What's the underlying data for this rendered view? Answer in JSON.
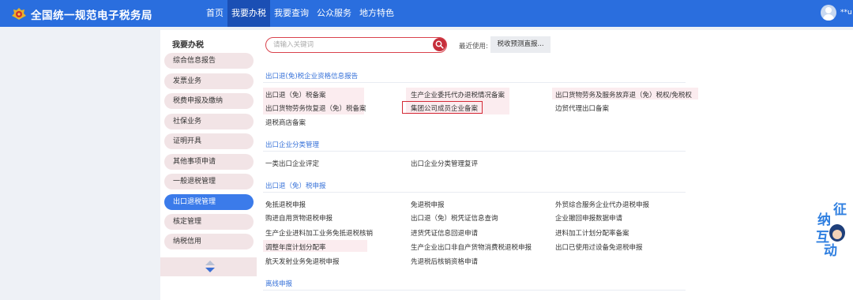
{
  "header": {
    "site_title": "全国统一规范电子税务局",
    "nav": [
      "首页",
      "我要办税",
      "我要查询",
      "公众服务",
      "地方特色"
    ],
    "active_nav_index": 1,
    "user_name": "**u"
  },
  "sidebar": {
    "title": "我要办税",
    "items": [
      "综合信息报告",
      "发票业务",
      "税费申报及缴纳",
      "社保业务",
      "证明开具",
      "其他事项申请",
      "一般退税管理",
      "出口退税管理",
      "核定管理",
      "纳税信用"
    ],
    "active_index": 7
  },
  "search": {
    "placeholder": "请输入关键词",
    "value": "",
    "recent_label": "最近使用:",
    "recent_item": "税收预测直报..."
  },
  "sections": [
    {
      "title": "出口退(免)税企业资格信息报告",
      "links": [
        "出口退（免）税备案",
        "生产企业委托代办退税情况备案",
        "出口货物劳务及服务放弃退（免）税权/免税权",
        "出口货物劳务恢复退（免）税备案",
        "集团公司成员企业备案",
        "边贸代理出口备案",
        "退税商店备案"
      ]
    },
    {
      "title": "出口企业分类管理",
      "links": [
        "一类出口企业评定",
        "出口企业分类管理复评"
      ]
    },
    {
      "title": "出口退（免）税申报",
      "links": [
        "免抵退税申报",
        "免退税申报",
        "外贸综合服务企业代办退税申报",
        "购进自用货物退税申报",
        "出口退（免）税凭证信息查询",
        "企业撤回申报数据申请",
        "生产企业进料加工业务免抵退税核销",
        "进货凭证信息回退申请",
        "进料加工计划分配率备案",
        "调整年度计划分配率",
        "生产企业出口非自产货物消费税退税申报",
        "出口已使用过设备免退税申报",
        "航天发射业务免退税申报",
        "先退税后核销资格申请"
      ]
    },
    {
      "title": "离线申报",
      "links": []
    }
  ],
  "float_widget": {
    "chars": [
      "征",
      "纳",
      "互",
      "动"
    ]
  },
  "colors": {
    "topbar": "#2a6ede",
    "active_nav": "#1b4fb4",
    "accent_red": "#d42a36",
    "link_blue": "#3570d8",
    "highlight_bg": "#fbecef"
  }
}
